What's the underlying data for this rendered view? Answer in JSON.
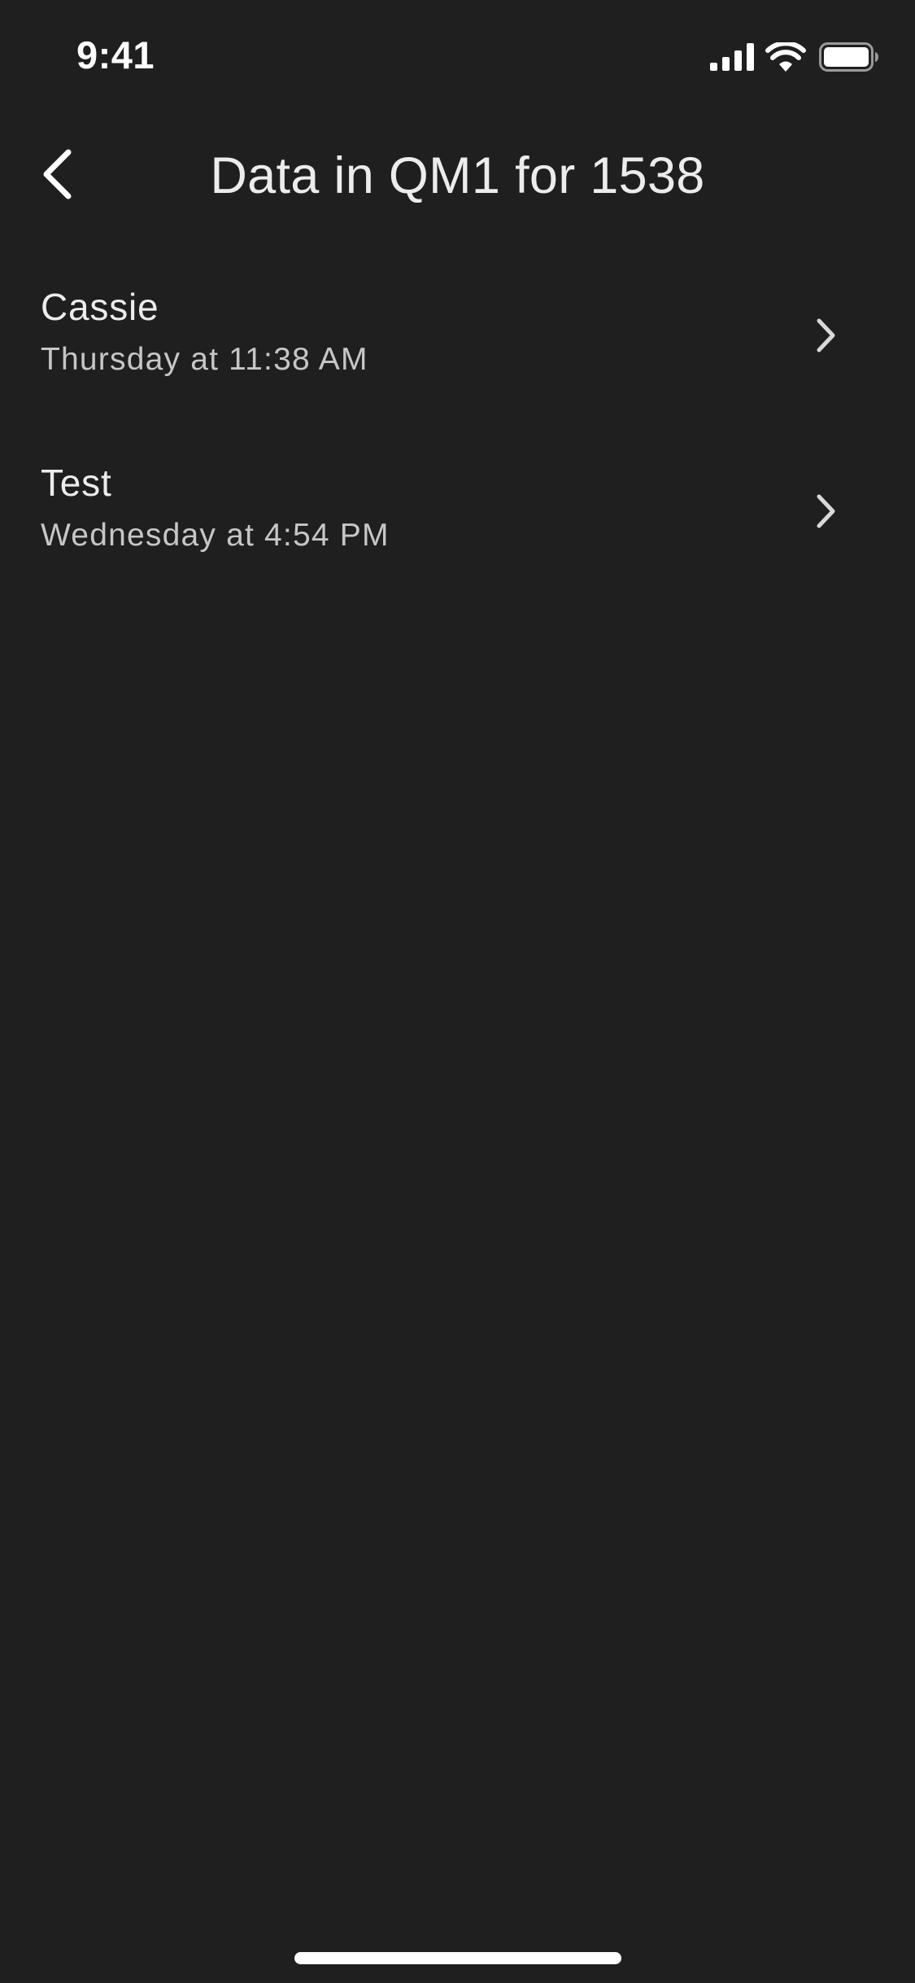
{
  "status_bar": {
    "time": "9:41",
    "icons": [
      "signal-icon",
      "wifi-icon",
      "battery-icon"
    ]
  },
  "nav": {
    "back_icon": "chevron-left-icon",
    "title": "Data in QM1 for 1538"
  },
  "entries": [
    {
      "name": "Cassie",
      "time": "Thursday at 11:38 AM",
      "icon": "chevron-right-icon"
    },
    {
      "name": "Test",
      "time": "Wednesday at 4:54 PM",
      "icon": "chevron-right-icon"
    }
  ],
  "colors": {
    "background": "#1f1f1f",
    "primary_text": "#ececec",
    "secondary_text": "#c6c6c6",
    "icon": "#ffffff"
  }
}
